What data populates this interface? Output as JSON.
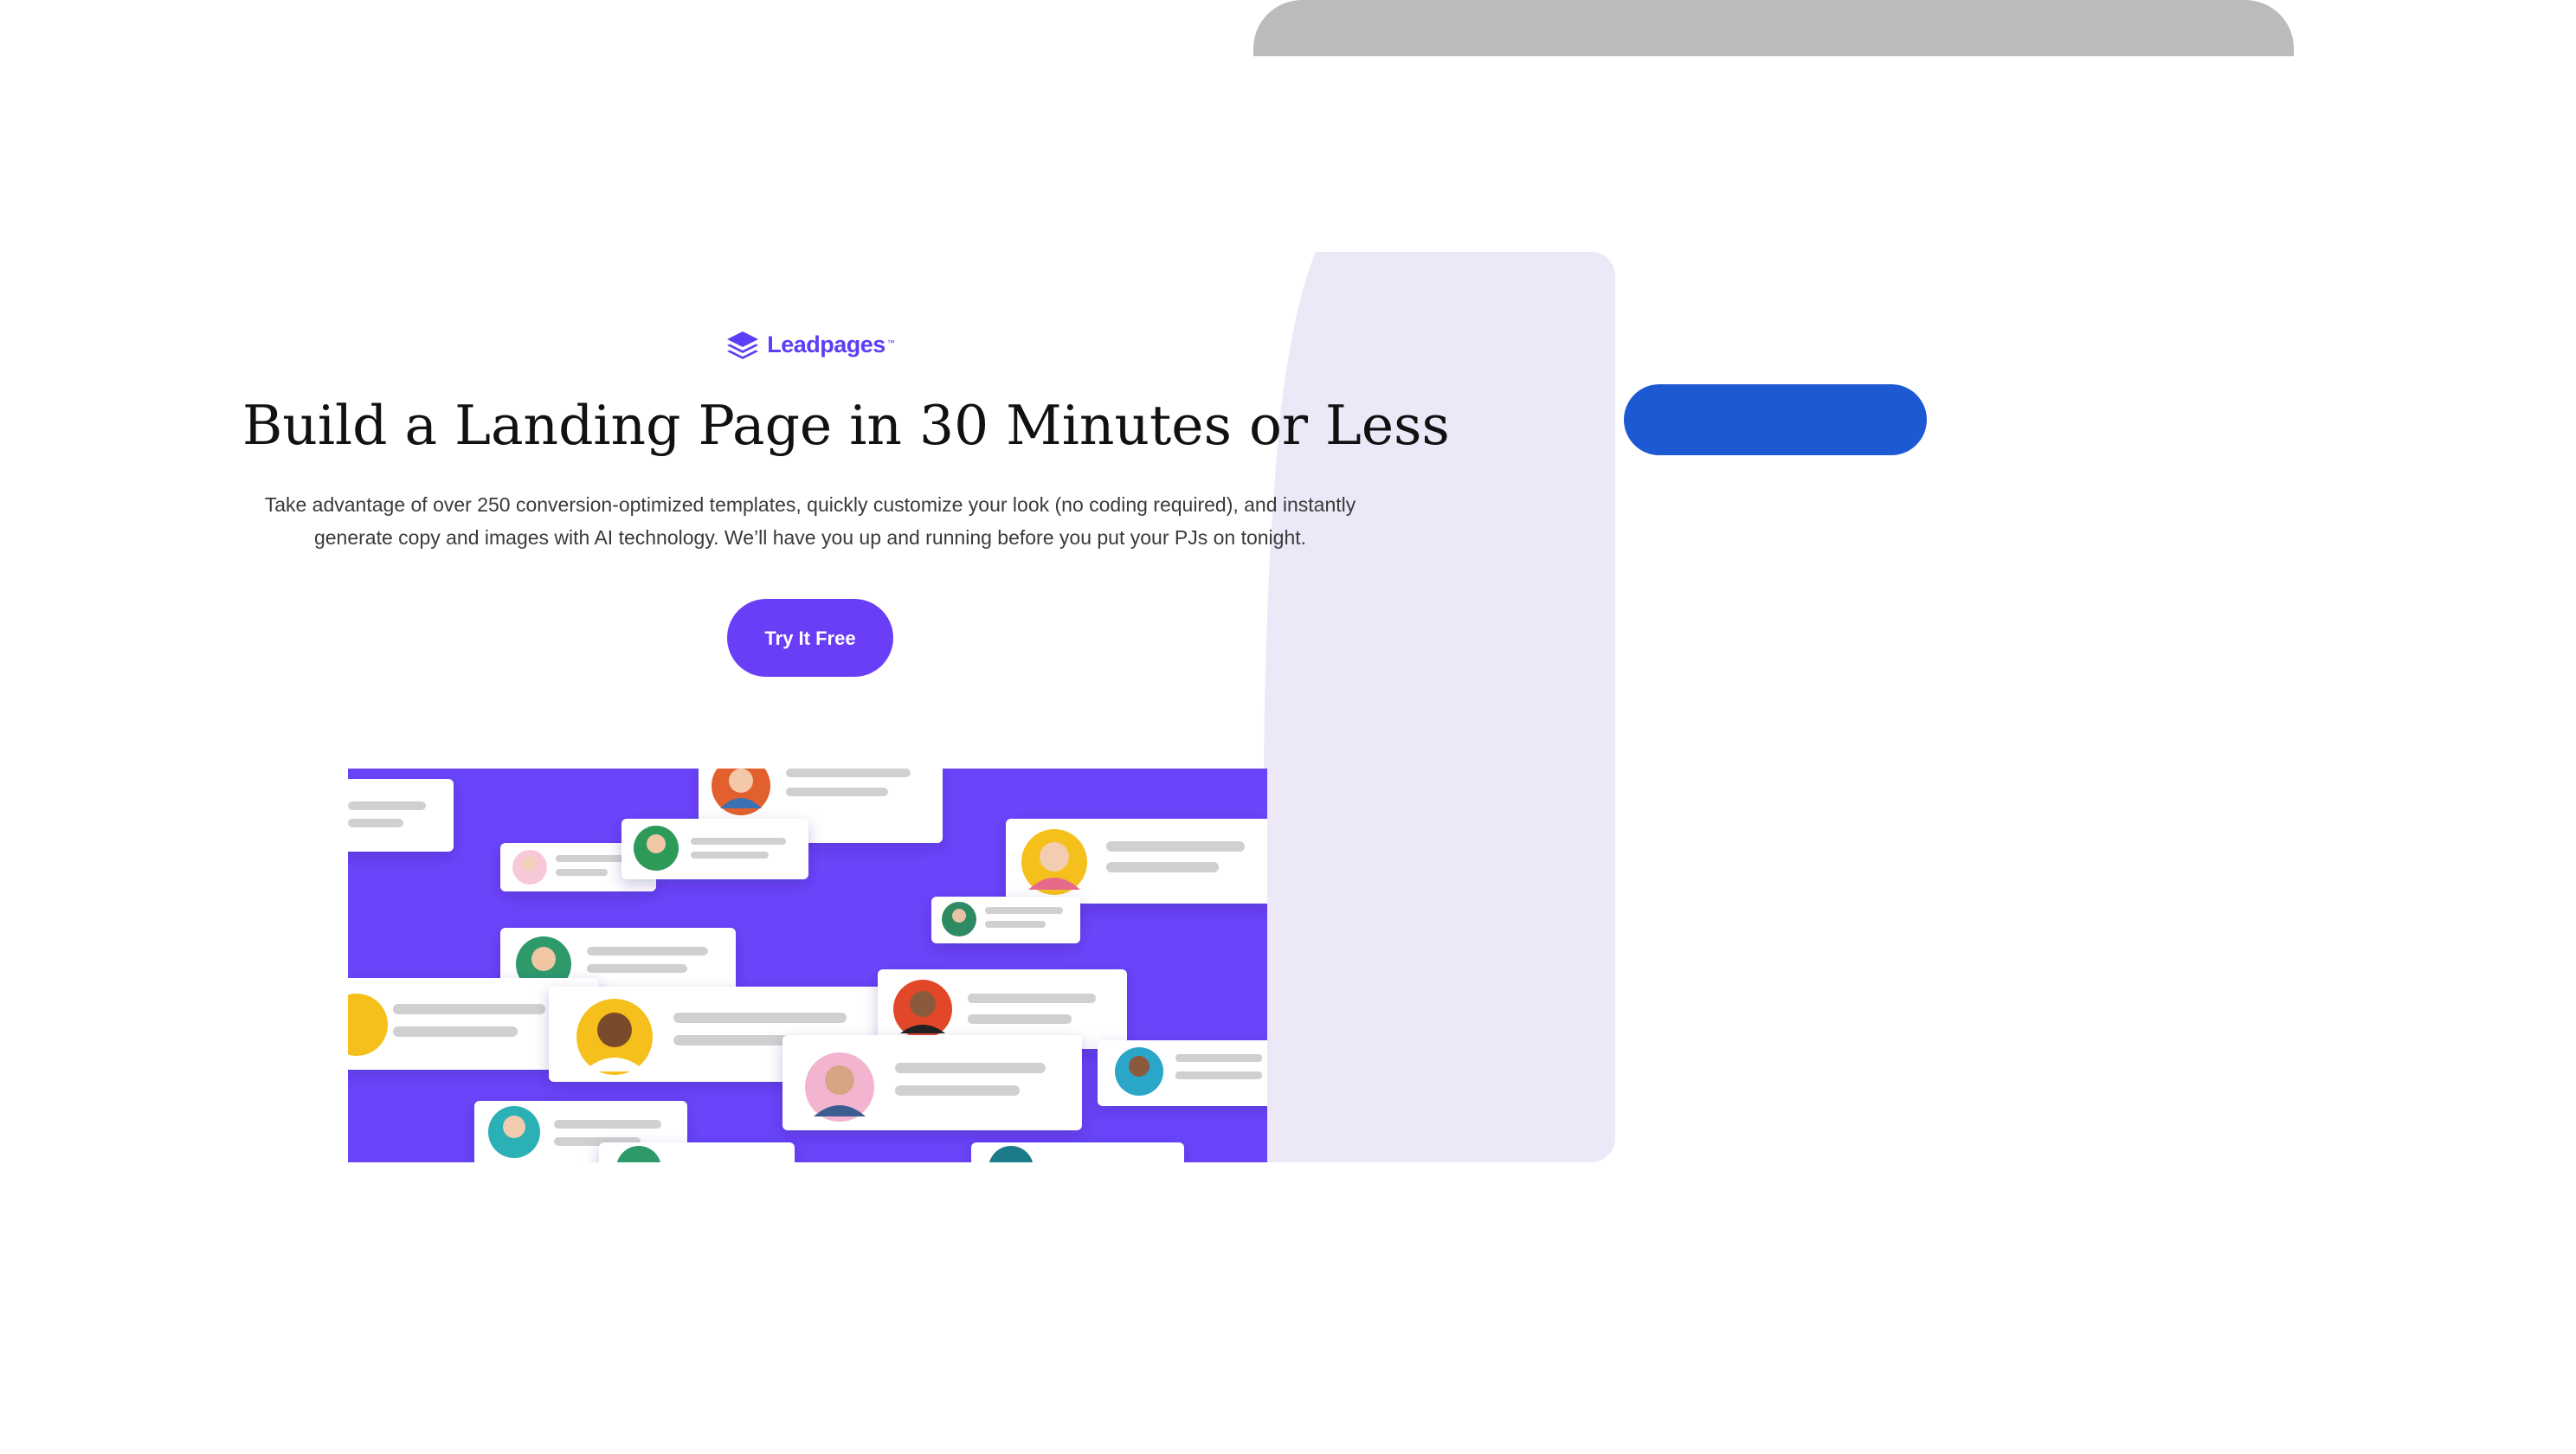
{
  "brand": {
    "name": "Leadpages",
    "trademark": "™",
    "color": "#5b3ef5",
    "icon": "stacked-layers-icon"
  },
  "hero": {
    "title": "Build a Landing Page in 30 Minutes or Less",
    "subtitle": "Take advantage of over 250 conversion-optimized templates, quickly customize your look (no coding required), and instantly generate copy and images with AI technology. We’ll have you up and running before you put your PJs on tonight.",
    "cta_label": "Try It Free",
    "cta_color": "#6a3ef7"
  },
  "colors": {
    "top_bar": "#bbbbbb",
    "lavender_panel": "#ece8f8",
    "blue_pill": "#1e59d4",
    "illustration_bg": "#6a44f9"
  },
  "illustration": {
    "icon": "profile-cards-illustration"
  }
}
